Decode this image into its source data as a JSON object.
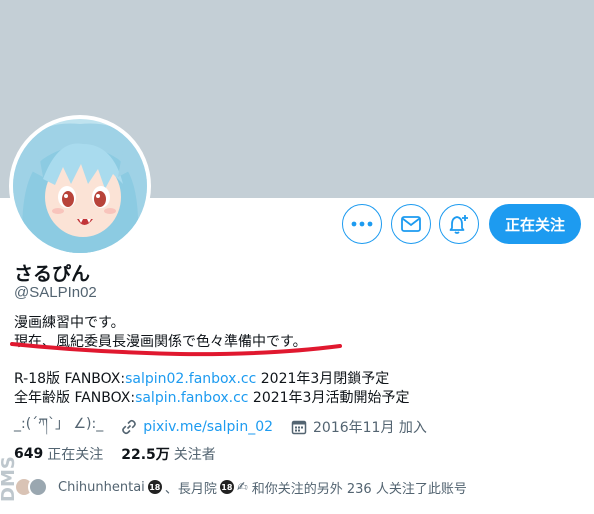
{
  "profile": {
    "display_name": "さるぴん",
    "handle": "@SALPIn02",
    "follow_button_label": "正在关注"
  },
  "bio": {
    "line1": "漫画練習中です。",
    "line2": "現在、風紀委員長漫画関係で色々準備中です。",
    "accent_underline_color": "#e0182f"
  },
  "fanbox": {
    "r18_prefix": "R-18版 FANBOX:",
    "r18_link": "salpin02.fanbox.cc",
    "r18_suffix": " 2021年3月閉鎖予定",
    "all_prefix": "全年齢版 FANBOX:",
    "all_link": "salpin.fanbox.cc",
    "all_suffix": " 2021年3月活動開始予定"
  },
  "meta": {
    "location": "_:(´ཀ`」 ∠):_",
    "website": "pixiv.me/salpin_02",
    "joined": "2016年11月 加入",
    "location_icon": "location-pin-icon",
    "link_icon": "link-icon",
    "calendar_icon": "calendar-icon"
  },
  "stats": {
    "following_count": "649",
    "following_label": "正在关注",
    "followers_count": "22.5万",
    "followers_label": "关注者"
  },
  "followers_you_know": {
    "name1": "Chihunhentai",
    "badge": "18",
    "sep": "、",
    "name2": "長月院",
    "suffix": "和你关注的另外 236 人关注了此账号"
  },
  "colors": {
    "banner": "#c4cfd6",
    "accent": "#1d9bf0"
  }
}
